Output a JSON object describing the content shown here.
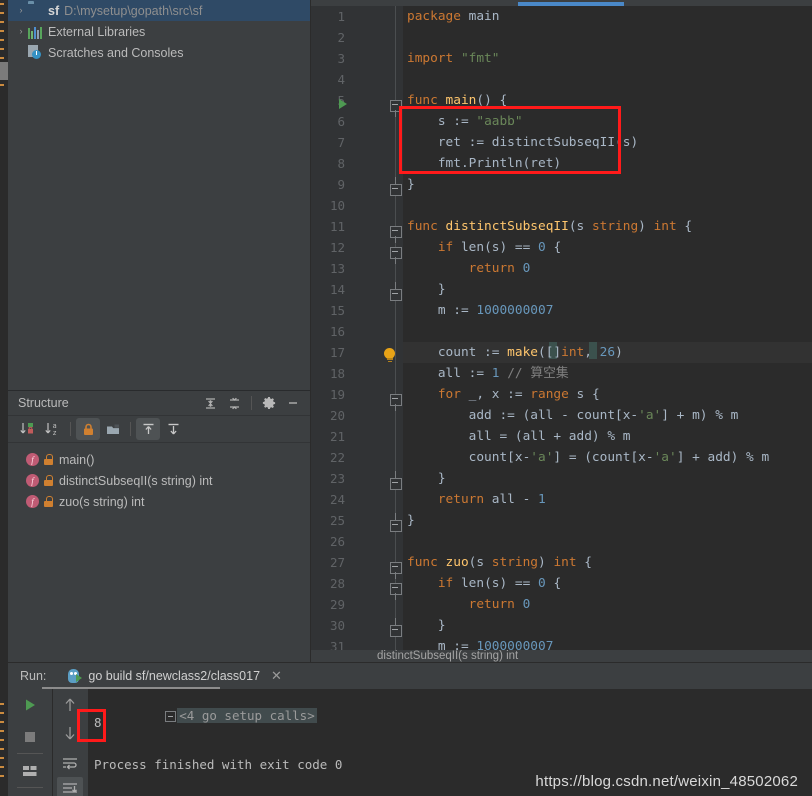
{
  "project": {
    "items": [
      {
        "arrow": "›",
        "icon": "folder-icon",
        "name": "sf",
        "path": "D:\\mysetup\\gopath\\src\\sf",
        "selected": true
      },
      {
        "arrow": "›",
        "icon": "libraries-icon",
        "name": "External Libraries",
        "path": "",
        "selected": false
      },
      {
        "arrow": "",
        "icon": "scratches-icon",
        "name": "Scratches and Consoles",
        "path": "",
        "selected": false
      }
    ]
  },
  "structure": {
    "title": "Structure",
    "header_icons": [
      "expand-all-icon",
      "collapse-all-icon",
      "gear-icon",
      "hide-icon"
    ],
    "toolbar_icons": [
      "sort-by-visibility-icon",
      "sort-alphabetically-icon",
      "show-non-public-icon",
      "show-fields-icon",
      "show-inherited-icon",
      "show-anonymous-icon"
    ],
    "items": [
      {
        "icon": "function-icon",
        "visibility": "lock-icon",
        "label": "main()"
      },
      {
        "icon": "function-icon",
        "visibility": "lock-icon",
        "label": "distinctSubseqII(s string) int"
      },
      {
        "icon": "function-icon",
        "visibility": "lock-icon",
        "label": "zuo(s string) int"
      }
    ]
  },
  "editor": {
    "active_tab_accent": "#4a88c7",
    "breadcrumb": "distinctSubseqII(s string) int",
    "highlight_box_color": "#ff1a1a",
    "caret_line": 17,
    "lines": [
      {
        "n": 1,
        "indent": 0,
        "tokens": [
          {
            "t": "package ",
            "c": "kw"
          },
          {
            "t": "main",
            "c": "id"
          }
        ]
      },
      {
        "n": 2,
        "indent": 0,
        "tokens": []
      },
      {
        "n": 3,
        "indent": 0,
        "tokens": [
          {
            "t": "import ",
            "c": "kw"
          },
          {
            "t": "\"fmt\"",
            "c": "str"
          }
        ]
      },
      {
        "n": 4,
        "indent": 0,
        "tokens": []
      },
      {
        "n": 5,
        "indent": 0,
        "tokens": [
          {
            "t": "func ",
            "c": "kw"
          },
          {
            "t": "main",
            "c": "fn"
          },
          {
            "t": "() {",
            "c": "id"
          }
        ]
      },
      {
        "n": 6,
        "indent": 1,
        "tokens": [
          {
            "t": "s := ",
            "c": "id"
          },
          {
            "t": "\"aabb\"",
            "c": "str"
          }
        ]
      },
      {
        "n": 7,
        "indent": 1,
        "tokens": [
          {
            "t": "ret := distinctSubseqII(s)",
            "c": "id"
          }
        ]
      },
      {
        "n": 8,
        "indent": 1,
        "tokens": [
          {
            "t": "fmt.",
            "c": "id"
          },
          {
            "t": "Println",
            "c": "id"
          },
          {
            "t": "(ret)",
            "c": "id"
          }
        ]
      },
      {
        "n": 9,
        "indent": 0,
        "tokens": [
          {
            "t": "}",
            "c": "id"
          }
        ]
      },
      {
        "n": 10,
        "indent": 0,
        "tokens": []
      },
      {
        "n": 11,
        "indent": 0,
        "tokens": [
          {
            "t": "func ",
            "c": "kw"
          },
          {
            "t": "distinctSubseqII",
            "c": "fn"
          },
          {
            "t": "(s ",
            "c": "id"
          },
          {
            "t": "string",
            "c": "kw"
          },
          {
            "t": ") ",
            "c": "id"
          },
          {
            "t": "int",
            "c": "kw"
          },
          {
            "t": " {",
            "c": "id"
          }
        ]
      },
      {
        "n": 12,
        "indent": 1,
        "tokens": [
          {
            "t": "if ",
            "c": "kw"
          },
          {
            "t": "len",
            "c": "id"
          },
          {
            "t": "(s) == ",
            "c": "id"
          },
          {
            "t": "0",
            "c": "num"
          },
          {
            "t": " {",
            "c": "id"
          }
        ]
      },
      {
        "n": 13,
        "indent": 2,
        "tokens": [
          {
            "t": "return ",
            "c": "kw"
          },
          {
            "t": "0",
            "c": "num"
          }
        ]
      },
      {
        "n": 14,
        "indent": 1,
        "tokens": [
          {
            "t": "}",
            "c": "id"
          }
        ]
      },
      {
        "n": 15,
        "indent": 1,
        "tokens": [
          {
            "t": "m := ",
            "c": "id"
          },
          {
            "t": "1000000007",
            "c": "num"
          }
        ]
      },
      {
        "n": 16,
        "indent": 0,
        "tokens": []
      },
      {
        "n": 17,
        "indent": 1,
        "tokens": [
          {
            "t": "count := ",
            "c": "id"
          },
          {
            "t": "make",
            "c": "fn"
          },
          {
            "t": "([]",
            "c": "id"
          },
          {
            "t": "int",
            "c": "kw"
          },
          {
            "t": ", ",
            "c": "id"
          },
          {
            "t": "26",
            "c": "num"
          },
          {
            "t": ")",
            "c": "id"
          }
        ]
      },
      {
        "n": 18,
        "indent": 1,
        "tokens": [
          {
            "t": "all := ",
            "c": "id"
          },
          {
            "t": "1",
            "c": "num"
          },
          {
            "t": " ",
            "c": "id"
          },
          {
            "t": "// 算空集",
            "c": "cmt"
          }
        ]
      },
      {
        "n": 19,
        "indent": 1,
        "tokens": [
          {
            "t": "for ",
            "c": "kw"
          },
          {
            "t": "_, x := ",
            "c": "id"
          },
          {
            "t": "range ",
            "c": "kw"
          },
          {
            "t": "s {",
            "c": "id"
          }
        ]
      },
      {
        "n": 20,
        "indent": 2,
        "tokens": [
          {
            "t": "add := (all - count[x-",
            "c": "id"
          },
          {
            "t": "'a'",
            "c": "str"
          },
          {
            "t": "] + m) % m",
            "c": "id"
          }
        ]
      },
      {
        "n": 21,
        "indent": 2,
        "tokens": [
          {
            "t": "all = (all + add) % m",
            "c": "id"
          }
        ]
      },
      {
        "n": 22,
        "indent": 2,
        "tokens": [
          {
            "t": "count[x-",
            "c": "id"
          },
          {
            "t": "'a'",
            "c": "str"
          },
          {
            "t": "] = (count[x-",
            "c": "id"
          },
          {
            "t": "'a'",
            "c": "str"
          },
          {
            "t": "] + add) % m",
            "c": "id"
          }
        ]
      },
      {
        "n": 23,
        "indent": 1,
        "tokens": [
          {
            "t": "}",
            "c": "id"
          }
        ]
      },
      {
        "n": 24,
        "indent": 1,
        "tokens": [
          {
            "t": "return ",
            "c": "kw"
          },
          {
            "t": "all - ",
            "c": "id"
          },
          {
            "t": "1",
            "c": "num"
          }
        ]
      },
      {
        "n": 25,
        "indent": 0,
        "tokens": [
          {
            "t": "}",
            "c": "id"
          }
        ]
      },
      {
        "n": 26,
        "indent": 0,
        "tokens": []
      },
      {
        "n": 27,
        "indent": 0,
        "tokens": [
          {
            "t": "func ",
            "c": "kw"
          },
          {
            "t": "zuo",
            "c": "fn"
          },
          {
            "t": "(s ",
            "c": "id"
          },
          {
            "t": "string",
            "c": "kw"
          },
          {
            "t": ") ",
            "c": "id"
          },
          {
            "t": "int",
            "c": "kw"
          },
          {
            "t": " {",
            "c": "id"
          }
        ]
      },
      {
        "n": 28,
        "indent": 1,
        "tokens": [
          {
            "t": "if ",
            "c": "kw"
          },
          {
            "t": "len",
            "c": "id"
          },
          {
            "t": "(s) == ",
            "c": "id"
          },
          {
            "t": "0",
            "c": "num"
          },
          {
            "t": " {",
            "c": "id"
          }
        ]
      },
      {
        "n": 29,
        "indent": 2,
        "tokens": [
          {
            "t": "return ",
            "c": "kw"
          },
          {
            "t": "0",
            "c": "num"
          }
        ]
      },
      {
        "n": 30,
        "indent": 1,
        "tokens": [
          {
            "t": "}",
            "c": "id"
          }
        ]
      },
      {
        "n": 31,
        "indent": 1,
        "tokens": [
          {
            "t": "m := ",
            "c": "id"
          },
          {
            "t": "1000000007",
            "c": "num"
          }
        ]
      }
    ]
  },
  "run_window": {
    "label": "Run:",
    "tab_title": "go build sf/newclass2/class017",
    "tab_close": "✕",
    "side_buttons": [
      "rerun-icon",
      "stop-icon",
      "layout-icon",
      "scroll-up-icon",
      "scroll-down-icon",
      "soft-wrap-icon",
      "scroll-to-end-icon"
    ],
    "console": {
      "folded_line": "<4 go setup calls>",
      "output": "8",
      "finished": "Process finished with exit code 0"
    }
  },
  "watermark": "https://blog.csdn.net/weixin_48502062"
}
